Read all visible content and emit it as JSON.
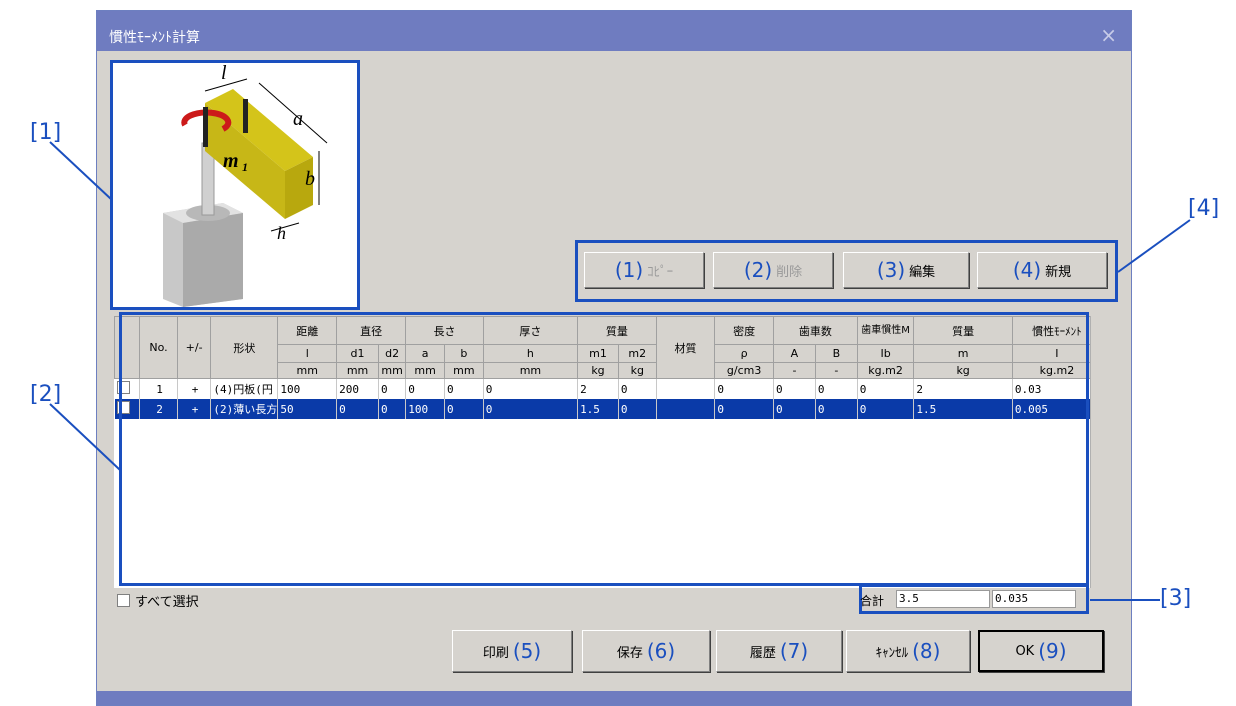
{
  "dialog": {
    "title": "慣性ﾓｰﾒﾝﾄ計算",
    "close_glyph": "×"
  },
  "callouts": [
    "[1]",
    "[2]",
    "[3]",
    "[4]"
  ],
  "diagram": {
    "labels": {
      "l": "l",
      "a": "a",
      "b": "b",
      "h": "h",
      "m": "m",
      "m_sub": "1"
    }
  },
  "toolbar": {
    "buttons": [
      {
        "num": "(1)",
        "label": "ｺﾋﾟｰ",
        "enabled": false
      },
      {
        "num": "(2)",
        "label": "削除",
        "enabled": false
      },
      {
        "num": "(3)",
        "label": "編集",
        "enabled": true
      },
      {
        "num": "(4)",
        "label": "新規",
        "enabled": true
      }
    ]
  },
  "grid": {
    "headers": {
      "no": "No.",
      "sign": "+/-",
      "shape": "形状",
      "distance": "距離",
      "diameter": "直径",
      "length": "長さ",
      "thickness": "厚さ",
      "mass": "質量",
      "material": "材質",
      "density": "密度",
      "gear_count": "歯車数",
      "gear_inertia": "歯車慣性M",
      "mass2": "質量",
      "inertia": "慣性ﾓｰﾒﾝﾄ"
    },
    "sym": [
      "l",
      "d1",
      "d2",
      "a",
      "b",
      "h",
      "m1",
      "m2",
      "ρ",
      "A",
      "B",
      "Ib",
      "m",
      "I"
    ],
    "units": [
      "mm",
      "mm",
      "mm",
      "mm",
      "mm",
      "mm",
      "kg",
      "kg",
      "g/cm3",
      "-",
      "-",
      "kg.m2",
      "kg",
      "kg.m2"
    ],
    "rows": [
      {
        "no": "1",
        "sign": "+",
        "shape": "(4)円板(円",
        "l": "100",
        "d1": "200",
        "d2": "0",
        "a": "0",
        "b": "0",
        "h": "0",
        "m1": "2",
        "m2": "0",
        "material": "",
        "rho": "0",
        "A": "0",
        "B": "0",
        "Ib": "0",
        "m": "2",
        "I": "0.03",
        "selected": false
      },
      {
        "no": "2",
        "sign": "+",
        "shape": "(2)薄い長方",
        "l": "50",
        "d1": "0",
        "d2": "0",
        "a": "100",
        "b": "0",
        "h": "0",
        "m1": "1.5",
        "m2": "0",
        "material": "",
        "rho": "0",
        "A": "0",
        "B": "0",
        "Ib": "0",
        "m": "1.5",
        "I": "0.005",
        "selected": true
      }
    ]
  },
  "select_all": {
    "label": "すべて選択",
    "checked": false
  },
  "totals": {
    "label": "合計",
    "mass": "3.5",
    "inertia": "0.035"
  },
  "footer": {
    "print": {
      "label": "印刷",
      "num": "(5)"
    },
    "save": {
      "label": "保存",
      "num": "(6)"
    },
    "history": {
      "label": "履歴",
      "num": "(7)"
    },
    "cancel": {
      "label": "ｷｬﾝｾﾙ",
      "num": "(8)"
    },
    "ok": {
      "label": "OK",
      "num": "(9)"
    }
  },
  "colors": {
    "accent": "#1a4fbf",
    "selection": "#0a3aa8",
    "titlebar": "#6f7cc0",
    "dialog_bg": "#d6d3ce",
    "diagram_bar": "#d4c41a"
  }
}
